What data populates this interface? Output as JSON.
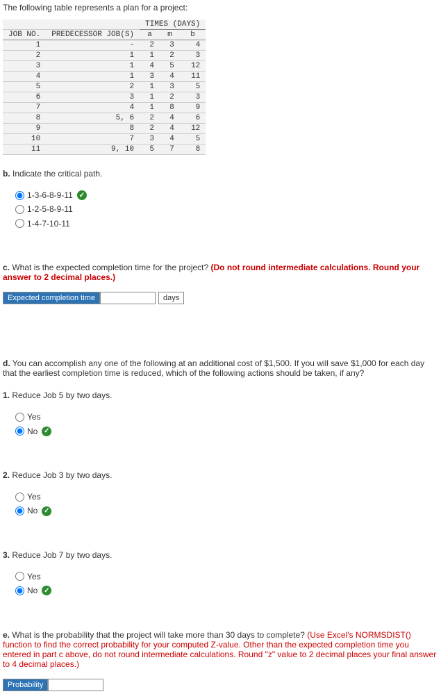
{
  "intro": "The following table represents a plan for a project:",
  "table": {
    "times_header": "TIMES (DAYS)",
    "col_job": "JOB NO.",
    "col_pred": "PREDECESSOR JOB(S)",
    "col_a": "a",
    "col_m": "m",
    "col_b": "b",
    "rows": [
      {
        "job": "1",
        "pred": "-",
        "a": "2",
        "m": "3",
        "b": "4"
      },
      {
        "job": "2",
        "pred": "1",
        "a": "1",
        "m": "2",
        "b": "3"
      },
      {
        "job": "3",
        "pred": "1",
        "a": "4",
        "m": "5",
        "b": "12"
      },
      {
        "job": "4",
        "pred": "1",
        "a": "3",
        "m": "4",
        "b": "11"
      },
      {
        "job": "5",
        "pred": "2",
        "a": "1",
        "m": "3",
        "b": "5"
      },
      {
        "job": "6",
        "pred": "3",
        "a": "1",
        "m": "2",
        "b": "3"
      },
      {
        "job": "7",
        "pred": "4",
        "a": "1",
        "m": "8",
        "b": "9"
      },
      {
        "job": "8",
        "pred": "5, 6",
        "a": "2",
        "m": "4",
        "b": "6"
      },
      {
        "job": "9",
        "pred": "8",
        "a": "2",
        "m": "4",
        "b": "12"
      },
      {
        "job": "10",
        "pred": "7",
        "a": "3",
        "m": "4",
        "b": "5"
      },
      {
        "job": "11",
        "pred": "9, 10",
        "a": "5",
        "m": "7",
        "b": "8"
      }
    ]
  },
  "b": {
    "letter": "b.",
    "prompt": "Indicate the critical path.",
    "opts": [
      "1-3-6-8-9-11",
      "1-2-5-8-9-11",
      "1-4-7-10-11"
    ],
    "selected": 0
  },
  "c": {
    "letter": "c.",
    "prompt": "What is the expected completion time for the project? ",
    "instr": "(Do not round intermediate calculations. Round your answer to 2 decimal places.)",
    "label": "Expected completion time",
    "unit": "days"
  },
  "d": {
    "letter": "d.",
    "prompt": "You can accomplish any one of the following at an additional cost of $1,500. If you will save $1,000 for each day that the earliest completion time is reduced, which of the following actions should be taken, if any?",
    "subs": [
      {
        "num": "1.",
        "q": "Reduce Job 5 by two days.",
        "opts": [
          "Yes",
          "No"
        ],
        "selected": 1
      },
      {
        "num": "2.",
        "q": "Reduce Job 3 by two days.",
        "opts": [
          "Yes",
          "No"
        ],
        "selected": 1
      },
      {
        "num": "3.",
        "q": "Reduce Job 7 by two days.",
        "opts": [
          "Yes",
          "No"
        ],
        "selected": 1
      }
    ]
  },
  "e": {
    "letter": "e.",
    "prompt": "What is the probability that the project will take more than 30 days to complete? ",
    "instr": "(Use Excel's NORMSDIST() function to find the correct probability for your computed Z-value. Other than the expected completion time you entered in part c above, do not round intermediate calculations. Round \"z\" value to 2 decimal places your final answer to 4 decimal places.)",
    "label": "Probability"
  }
}
